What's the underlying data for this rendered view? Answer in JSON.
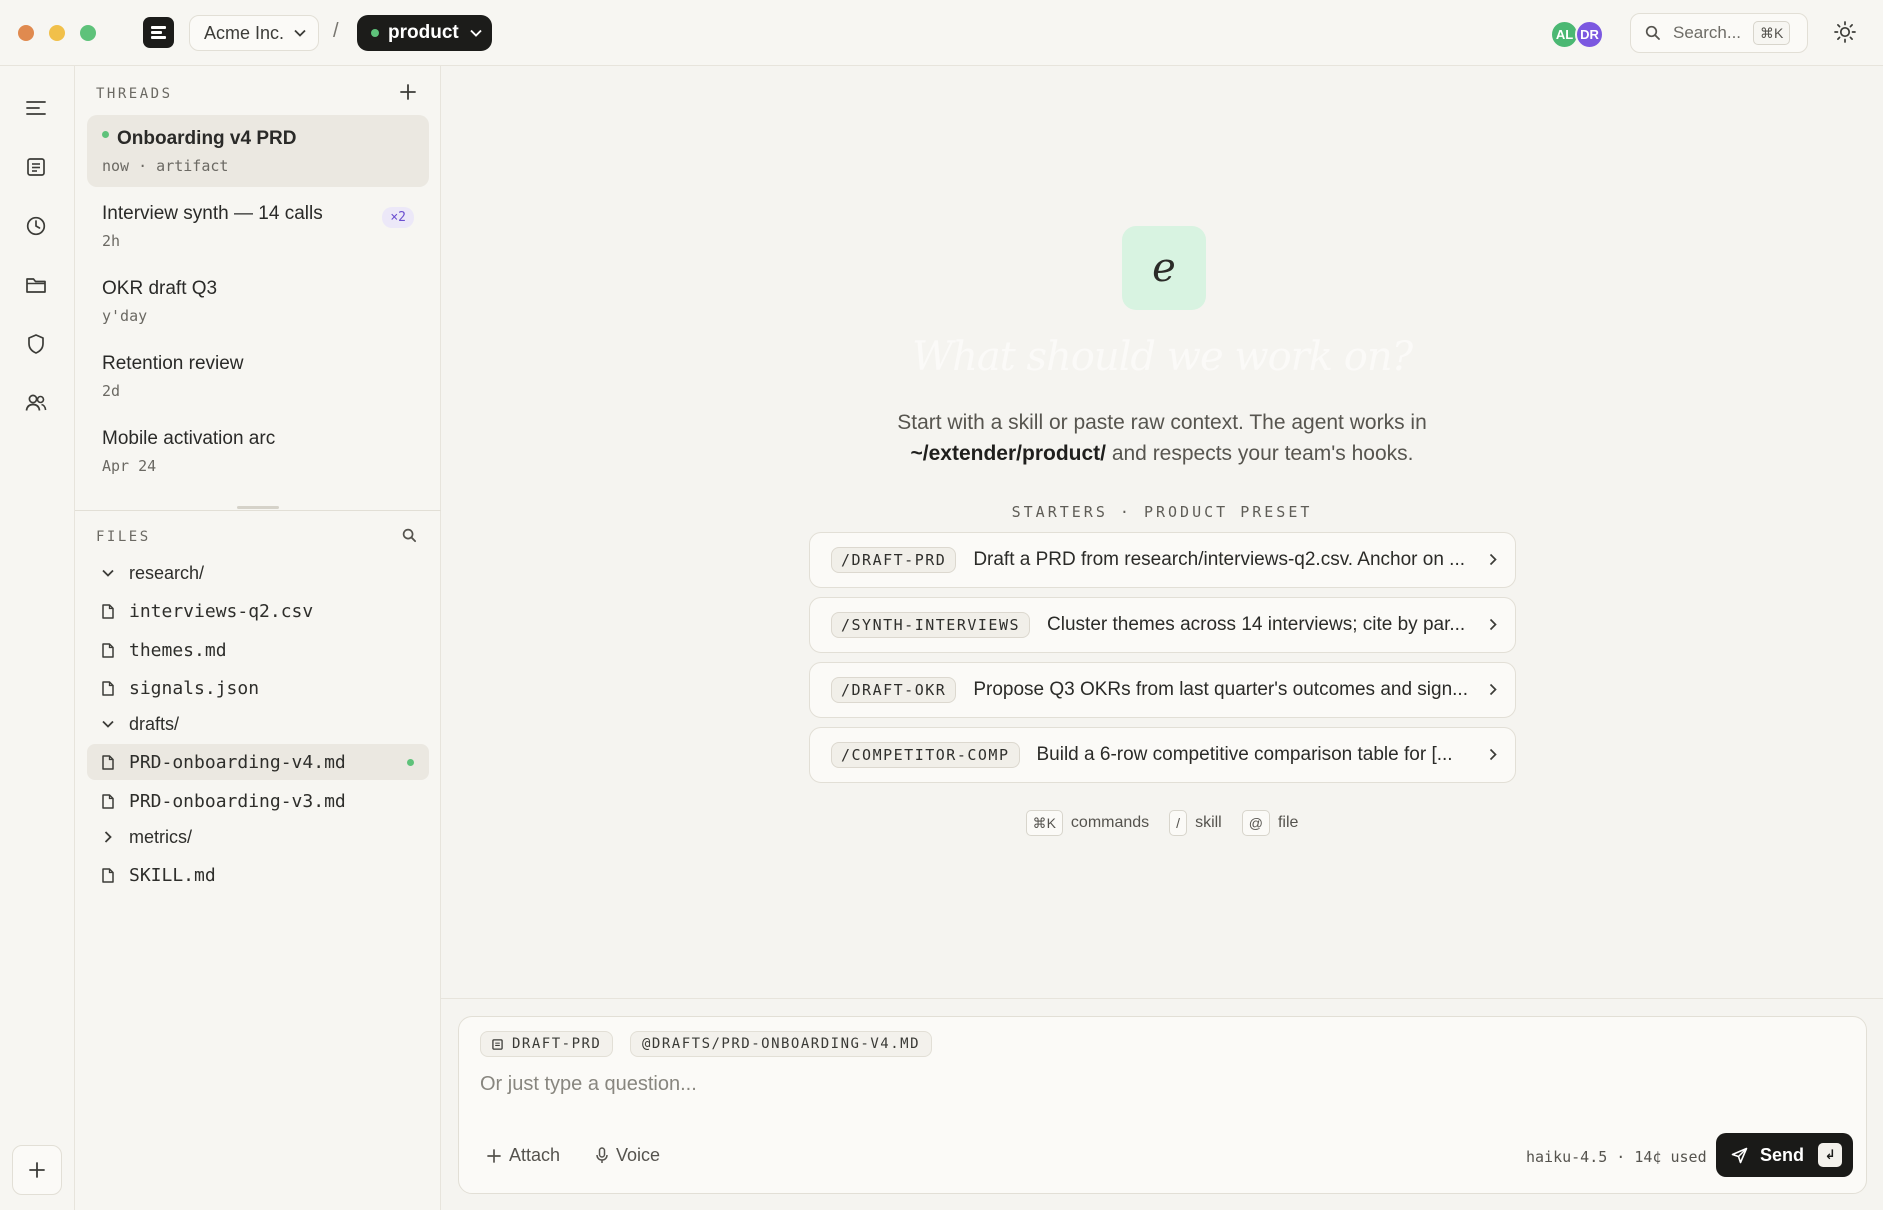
{
  "titlebar": {
    "org": "Acme Inc.",
    "separator": "/",
    "project": "product",
    "avatars": [
      {
        "initials": "AL",
        "color": "#4bb873"
      },
      {
        "initials": "DR",
        "color": "#7b58e0"
      }
    ],
    "search": {
      "label": "Search...",
      "shortcut": "⌘K"
    }
  },
  "rail": {
    "items": [
      "menu-icon",
      "document-icon",
      "history-icon",
      "folder-icon",
      "shield-icon",
      "users-icon"
    ],
    "add_icon": "plus-icon"
  },
  "threads": {
    "label": "THREADS",
    "items": [
      {
        "title": "Onboarding v4 PRD",
        "meta": "now · artifact",
        "active": true,
        "live": true
      },
      {
        "title": "Interview synth — 14 calls",
        "meta": "2h",
        "badge": "×2"
      },
      {
        "title": "OKR draft Q3",
        "meta": "y'day"
      },
      {
        "title": "Retention review",
        "meta": "2d"
      },
      {
        "title": "Mobile activation arc",
        "meta": "Apr 24"
      }
    ]
  },
  "files": {
    "label": "FILES",
    "items": [
      {
        "name": "research/",
        "type": "folder",
        "expanded": true
      },
      {
        "name": "interviews-q2.csv",
        "type": "file"
      },
      {
        "name": "themes.md",
        "type": "file"
      },
      {
        "name": "signals.json",
        "type": "file"
      },
      {
        "name": "drafts/",
        "type": "folder",
        "expanded": true
      },
      {
        "name": "PRD-onboarding-v4.md",
        "type": "file",
        "active": true
      },
      {
        "name": "PRD-onboarding-v3.md",
        "type": "file"
      },
      {
        "name": "metrics/",
        "type": "folder",
        "expanded": false
      },
      {
        "name": "SKILL.md",
        "type": "file"
      }
    ]
  },
  "main": {
    "logo_letter": "e",
    "title": "What should we work on?",
    "subtitle_line1": "Start with a skill or paste raw context. The agent works in",
    "subtitle_path": "~/extender/product/",
    "subtitle_line2": " and respects your team's hooks.",
    "starters_label": "STARTERS · PRODUCT PRESET",
    "starters": [
      {
        "tag": "/DRAFT-PRD",
        "desc": "Draft a PRD from research/interviews-q2.csv. Anchor on ..."
      },
      {
        "tag": "/SYNTH-INTERVIEWS",
        "desc": "Cluster themes across 14 interviews; cite by par..."
      },
      {
        "tag": "/DRAFT-OKR",
        "desc": "Propose Q3 OKRs from last quarter's outcomes and sign..."
      },
      {
        "tag": "/COMPETITOR-COMP",
        "desc": "Build a 6-row competitive comparison table for [..."
      }
    ],
    "hints": [
      {
        "key": "⌘K",
        "label": "commands"
      },
      {
        "key": "/",
        "label": "skill"
      },
      {
        "key": "@",
        "label": "file"
      }
    ]
  },
  "composer": {
    "chips": [
      "DRAFT-PRD",
      "@DRAFTS/PRD-ONBOARDING-V4.MD"
    ],
    "placeholder": "Or just type a question...",
    "attach": "Attach",
    "voice": "Voice",
    "usage": "haiku-4.5 · 14¢ used",
    "send": "Send",
    "enter_key": "↲"
  }
}
